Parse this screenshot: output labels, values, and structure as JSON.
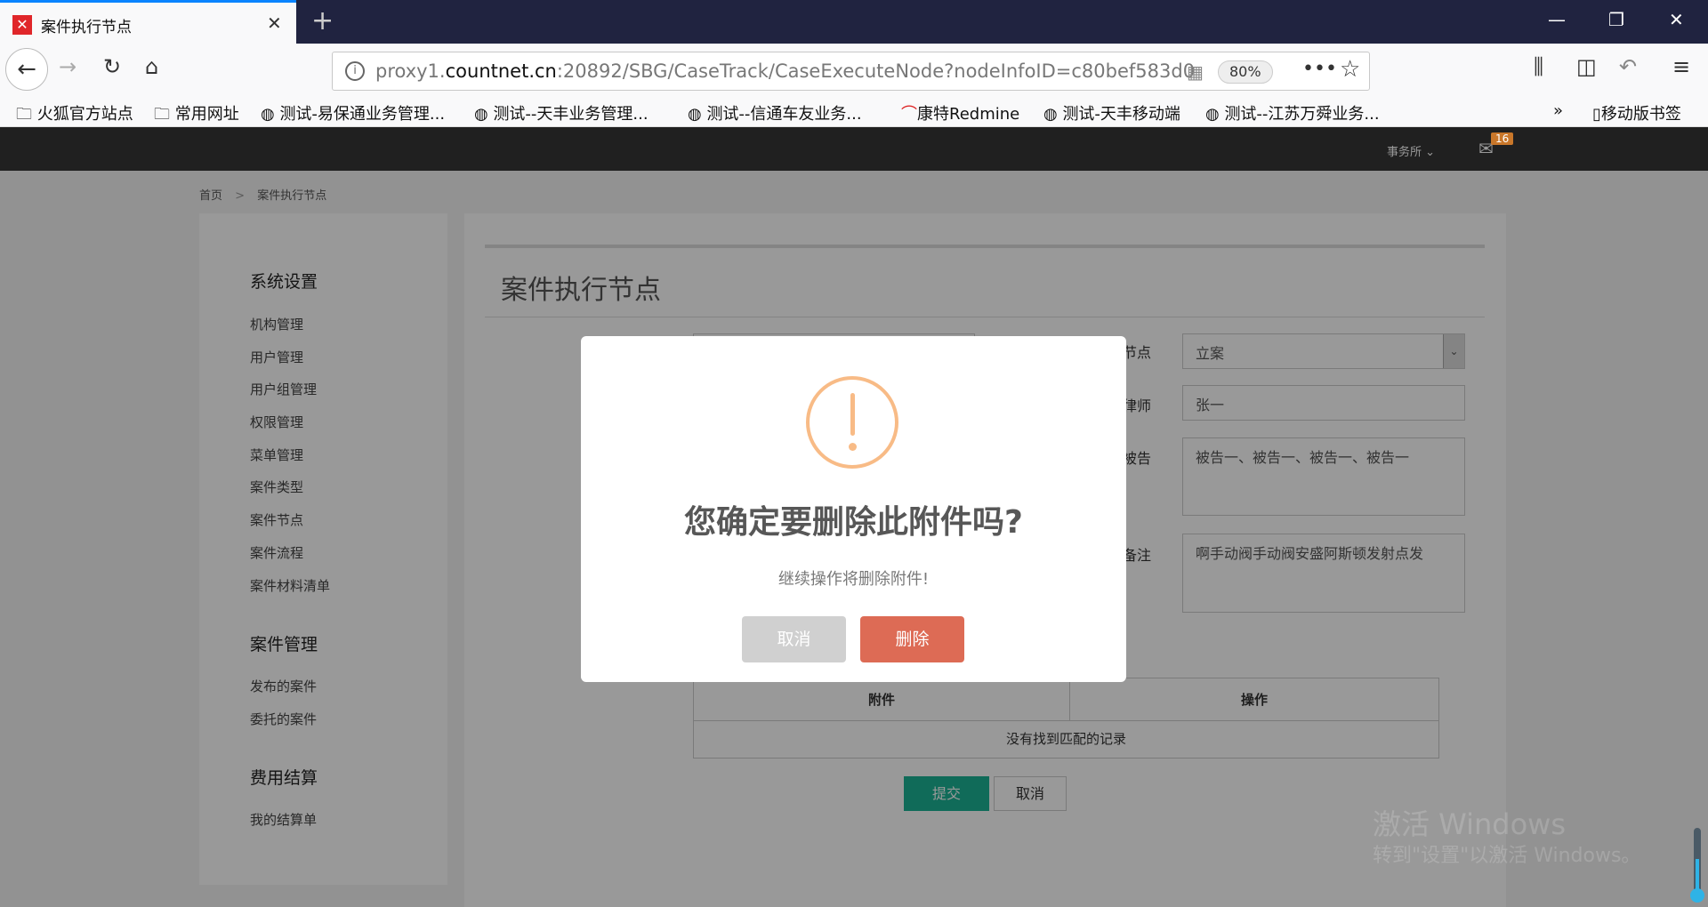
{
  "browser": {
    "tab_title": "案件执行节点",
    "url_prefix": "proxy1.",
    "url_domain": "countnet.cn",
    "url_rest": ":20892/SBG/CaseTrack/CaseExecuteNode?nodeInfoID=c80bef583d0",
    "zoom": "80%",
    "bookmarks": [
      "火狐官方站点",
      "常用网址",
      "测试-易保通业务管理...",
      "测试--天丰业务管理...",
      "测试--信通车友业务...",
      "康特Redmine",
      "测试-天丰移动端",
      "测试--江苏万舜业务..."
    ],
    "mobile_bookmarks": "移动版书签"
  },
  "header": {
    "org_menu": "事务所",
    "mail_count": "16"
  },
  "breadcrumb": {
    "home": "首页",
    "sep": ">",
    "current": "案件执行节点"
  },
  "sidebar": {
    "groups": [
      {
        "title": "系统设置",
        "items": [
          "机构管理",
          "用户管理",
          "用户组管理",
          "权限管理",
          "菜单管理",
          "案件类型",
          "案件节点",
          "案件流程",
          "案件材料清单"
        ]
      },
      {
        "title": "案件管理",
        "items": [
          "发布的案件",
          "委托的案件"
        ]
      },
      {
        "title": "费用结算",
        "items": [
          "我的结算单"
        ]
      }
    ]
  },
  "page": {
    "title": "案件执行节点",
    "form": {
      "node_label": "节点",
      "node_value": "立案",
      "lawyer_label": "律师",
      "lawyer_value": "张一",
      "defendant_label": "被告",
      "defendant_value": "被告一、被告一、被告一、被告一",
      "remark_label": "备注",
      "remark_value": "啊手动阀手动阀安盛阿斯顿发射点发"
    },
    "table": {
      "headers": [
        "附件",
        "操作"
      ],
      "empty": "没有找到匹配的记录"
    },
    "submit": "提交",
    "cancel": "取消"
  },
  "modal": {
    "title": "您确定要删除此附件吗?",
    "message": "继续操作将删除附件!",
    "cancel": "取消",
    "confirm": "删除",
    "icon_color": "#f8bb86",
    "confirm_color": "#dd6b55"
  },
  "watermark": {
    "line1": "激活 Windows",
    "line2": "转到\"设置\"以激活 Windows。"
  }
}
